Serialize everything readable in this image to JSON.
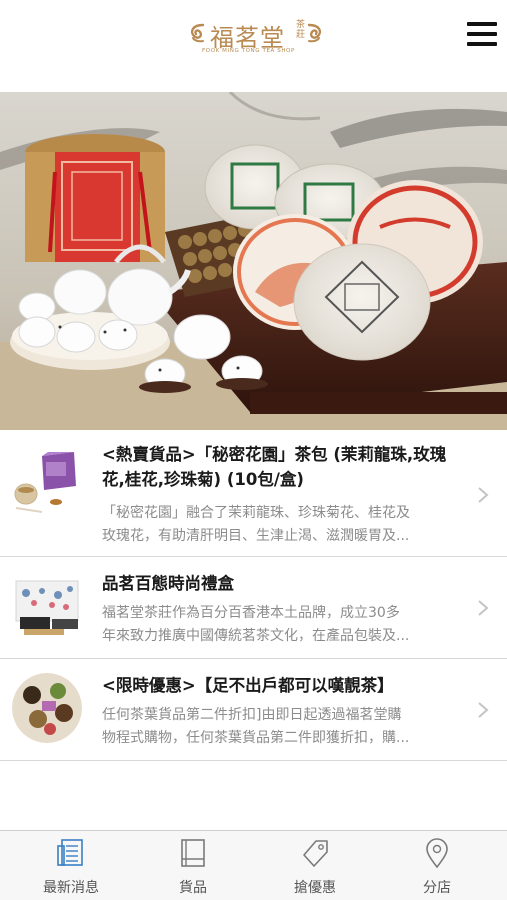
{
  "header": {
    "logo_main": "福茗堂",
    "logo_sub": "茶莊",
    "logo_tagline": "FOOK MING TONG TEA SHOP",
    "menu_icon": "hamburger-menu-icon"
  },
  "hero": {
    "image": "tea-gift-set-banner"
  },
  "news": [
    {
      "title": "<熱賣貨品>「秘密花園」茶包 (茉莉龍珠,玫瑰花,桂花,珍珠菊) (10包/盒)",
      "desc_line1": "「秘密花園」融合了茉莉龍珠、珍珠菊花、桂花及",
      "desc_line2": "玫瑰花，有助清肝明目、生津止渴、滋潤暖胃及...",
      "thumb_icon": "purple-tea-box-image"
    },
    {
      "title": "品茗百態時尚禮盒",
      "desc_line1": "福茗堂茶莊作為百分百香港本土品牌，成立30多",
      "desc_line2": "年來致力推廣中國傳統茗茶文化，在產品包裝及...",
      "thumb_icon": "gift-box-image"
    },
    {
      "title": "<限時優惠>【足不出戶都可以嘆靚茶】",
      "desc_line1": "任何茶葉貨品第二件折扣]由即日起透過福茗堂購",
      "desc_line2": "物程式購物，任何茶葉貨品第二件即獲折扣，購...",
      "thumb_icon": "tea-leaves-plate-image"
    }
  ],
  "tabs": [
    {
      "label": "最新消息",
      "icon": "newspaper-icon",
      "active": true
    },
    {
      "label": "貨品",
      "icon": "book-icon",
      "active": false
    },
    {
      "label": "搶優惠",
      "icon": "tag-icon",
      "active": false
    },
    {
      "label": "分店",
      "icon": "location-pin-icon",
      "active": false
    }
  ],
  "colors": {
    "brand": "#b98a52",
    "active_tab": "#3a7fc4",
    "inactive_tab": "#7a7a7a"
  }
}
